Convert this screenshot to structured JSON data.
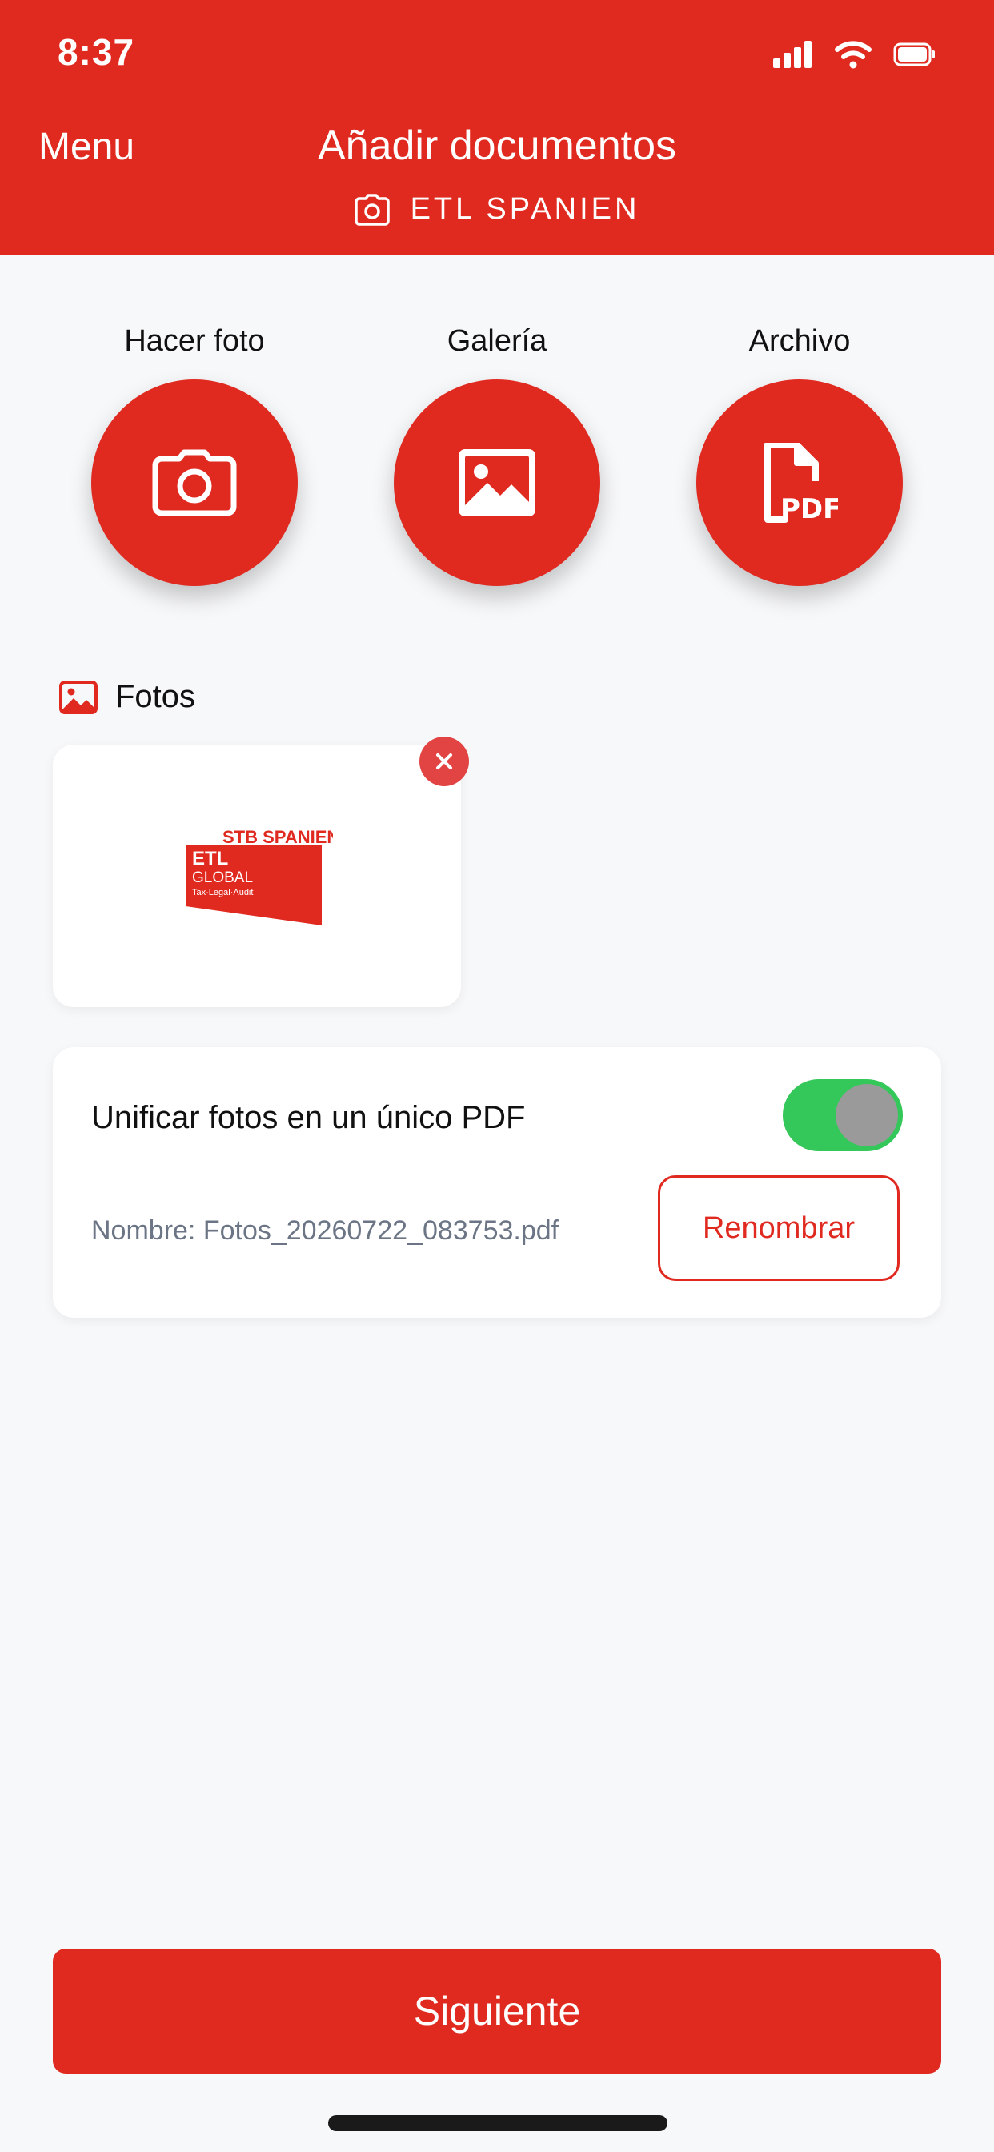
{
  "status_bar": {
    "time": "8:37"
  },
  "header": {
    "menu": "Menu",
    "title": "Añadir documentos",
    "subtitle": "ETL SPANIEN",
    "background": "#e02a20"
  },
  "actions": [
    {
      "label": "Hacer foto",
      "icon": "camera-icon"
    },
    {
      "label": "Galería",
      "icon": "image-icon"
    },
    {
      "label": "Archivo",
      "icon": "pdf-file-icon"
    }
  ],
  "photos_section": {
    "title": "Fotos",
    "logo": {
      "line1": "STB SPANIEN",
      "line2": "ETL",
      "line3": "GLOBAL",
      "line4": "Tax·Legal·Audit"
    }
  },
  "options": {
    "merge_label": "Unificar fotos en un único PDF",
    "merge_enabled": true,
    "filename": "Nombre: Fotos_20260722_083753.pdf",
    "rename_label": "Renombrar"
  },
  "footer": {
    "next_label": "Siguiente"
  },
  "colors": {
    "accent": "#e02a20",
    "toggle_on": "#34c759",
    "muted_text": "#6b7585"
  }
}
